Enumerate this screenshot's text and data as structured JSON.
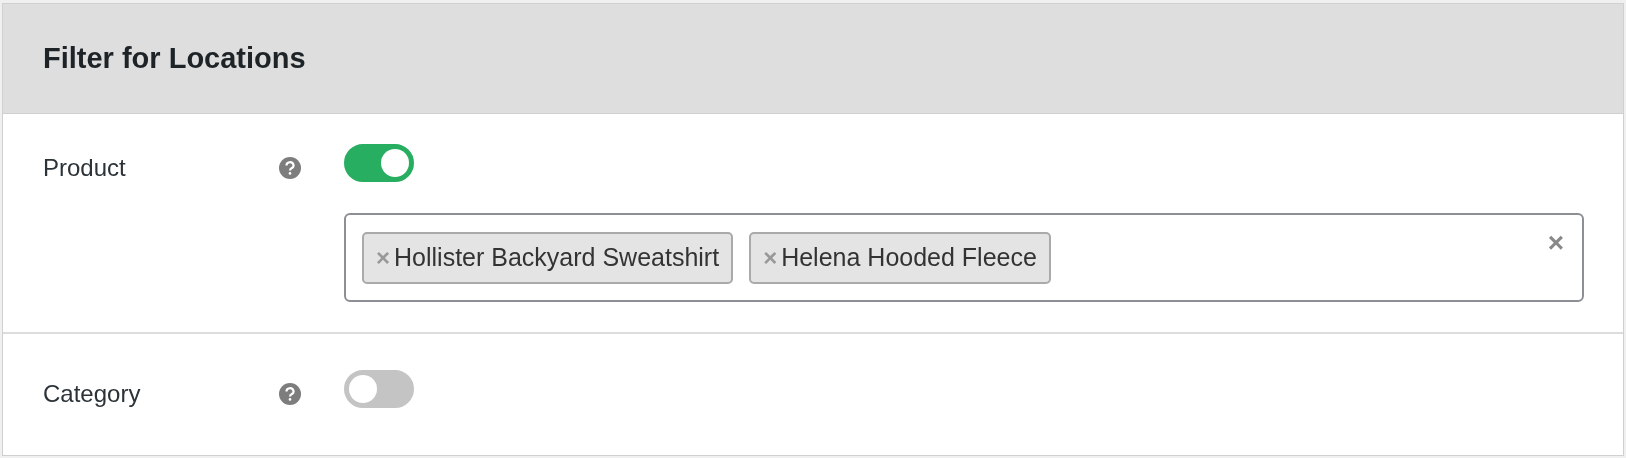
{
  "panel": {
    "title": "Filter for Locations"
  },
  "filters": [
    {
      "label": "Product",
      "on": true,
      "selection": {
        "tags": [
          {
            "remove": "×",
            "label": "Hollister Backyard Sweatshirt"
          },
          {
            "remove": "×",
            "label": "Helena Hooded Fleece"
          }
        ],
        "clear": "×"
      }
    },
    {
      "label": "Category",
      "on": false
    }
  ]
}
